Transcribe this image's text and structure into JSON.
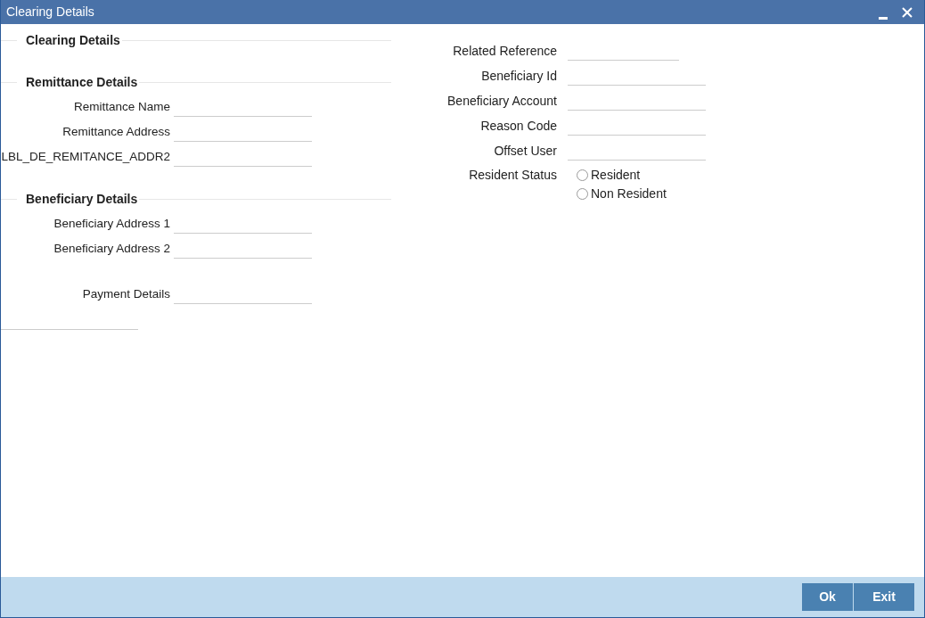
{
  "window": {
    "title": "Clearing Details"
  },
  "left_sections": [
    {
      "heading": "Clearing Details"
    },
    {
      "heading": "Remittance Details",
      "fields": [
        {
          "label": "Remittance Name"
        },
        {
          "label": "Remittance Address"
        },
        {
          "label": "LBL_DE_REMITANCE_ADDR2"
        }
      ]
    },
    {
      "heading": "Beneficiary Details",
      "fields": [
        {
          "label": "Beneficiary Address 1"
        },
        {
          "label": "Beneficiary Address 2"
        }
      ]
    }
  ],
  "payment_details": {
    "label": "Payment Details"
  },
  "right_fields": [
    {
      "label": "Related Reference",
      "kind": "short"
    },
    {
      "label": "Beneficiary Id",
      "kind": "long"
    },
    {
      "label": "Beneficiary Account",
      "kind": "long"
    },
    {
      "label": "Reason Code",
      "kind": "long"
    },
    {
      "label": "Offset User",
      "kind": "long"
    }
  ],
  "resident_status": {
    "label": "Resident Status",
    "options": [
      {
        "label": "Resident",
        "selected": false
      },
      {
        "label": "Non Resident",
        "selected": false
      }
    ]
  },
  "buttons": [
    "Ok",
    "Exit"
  ]
}
